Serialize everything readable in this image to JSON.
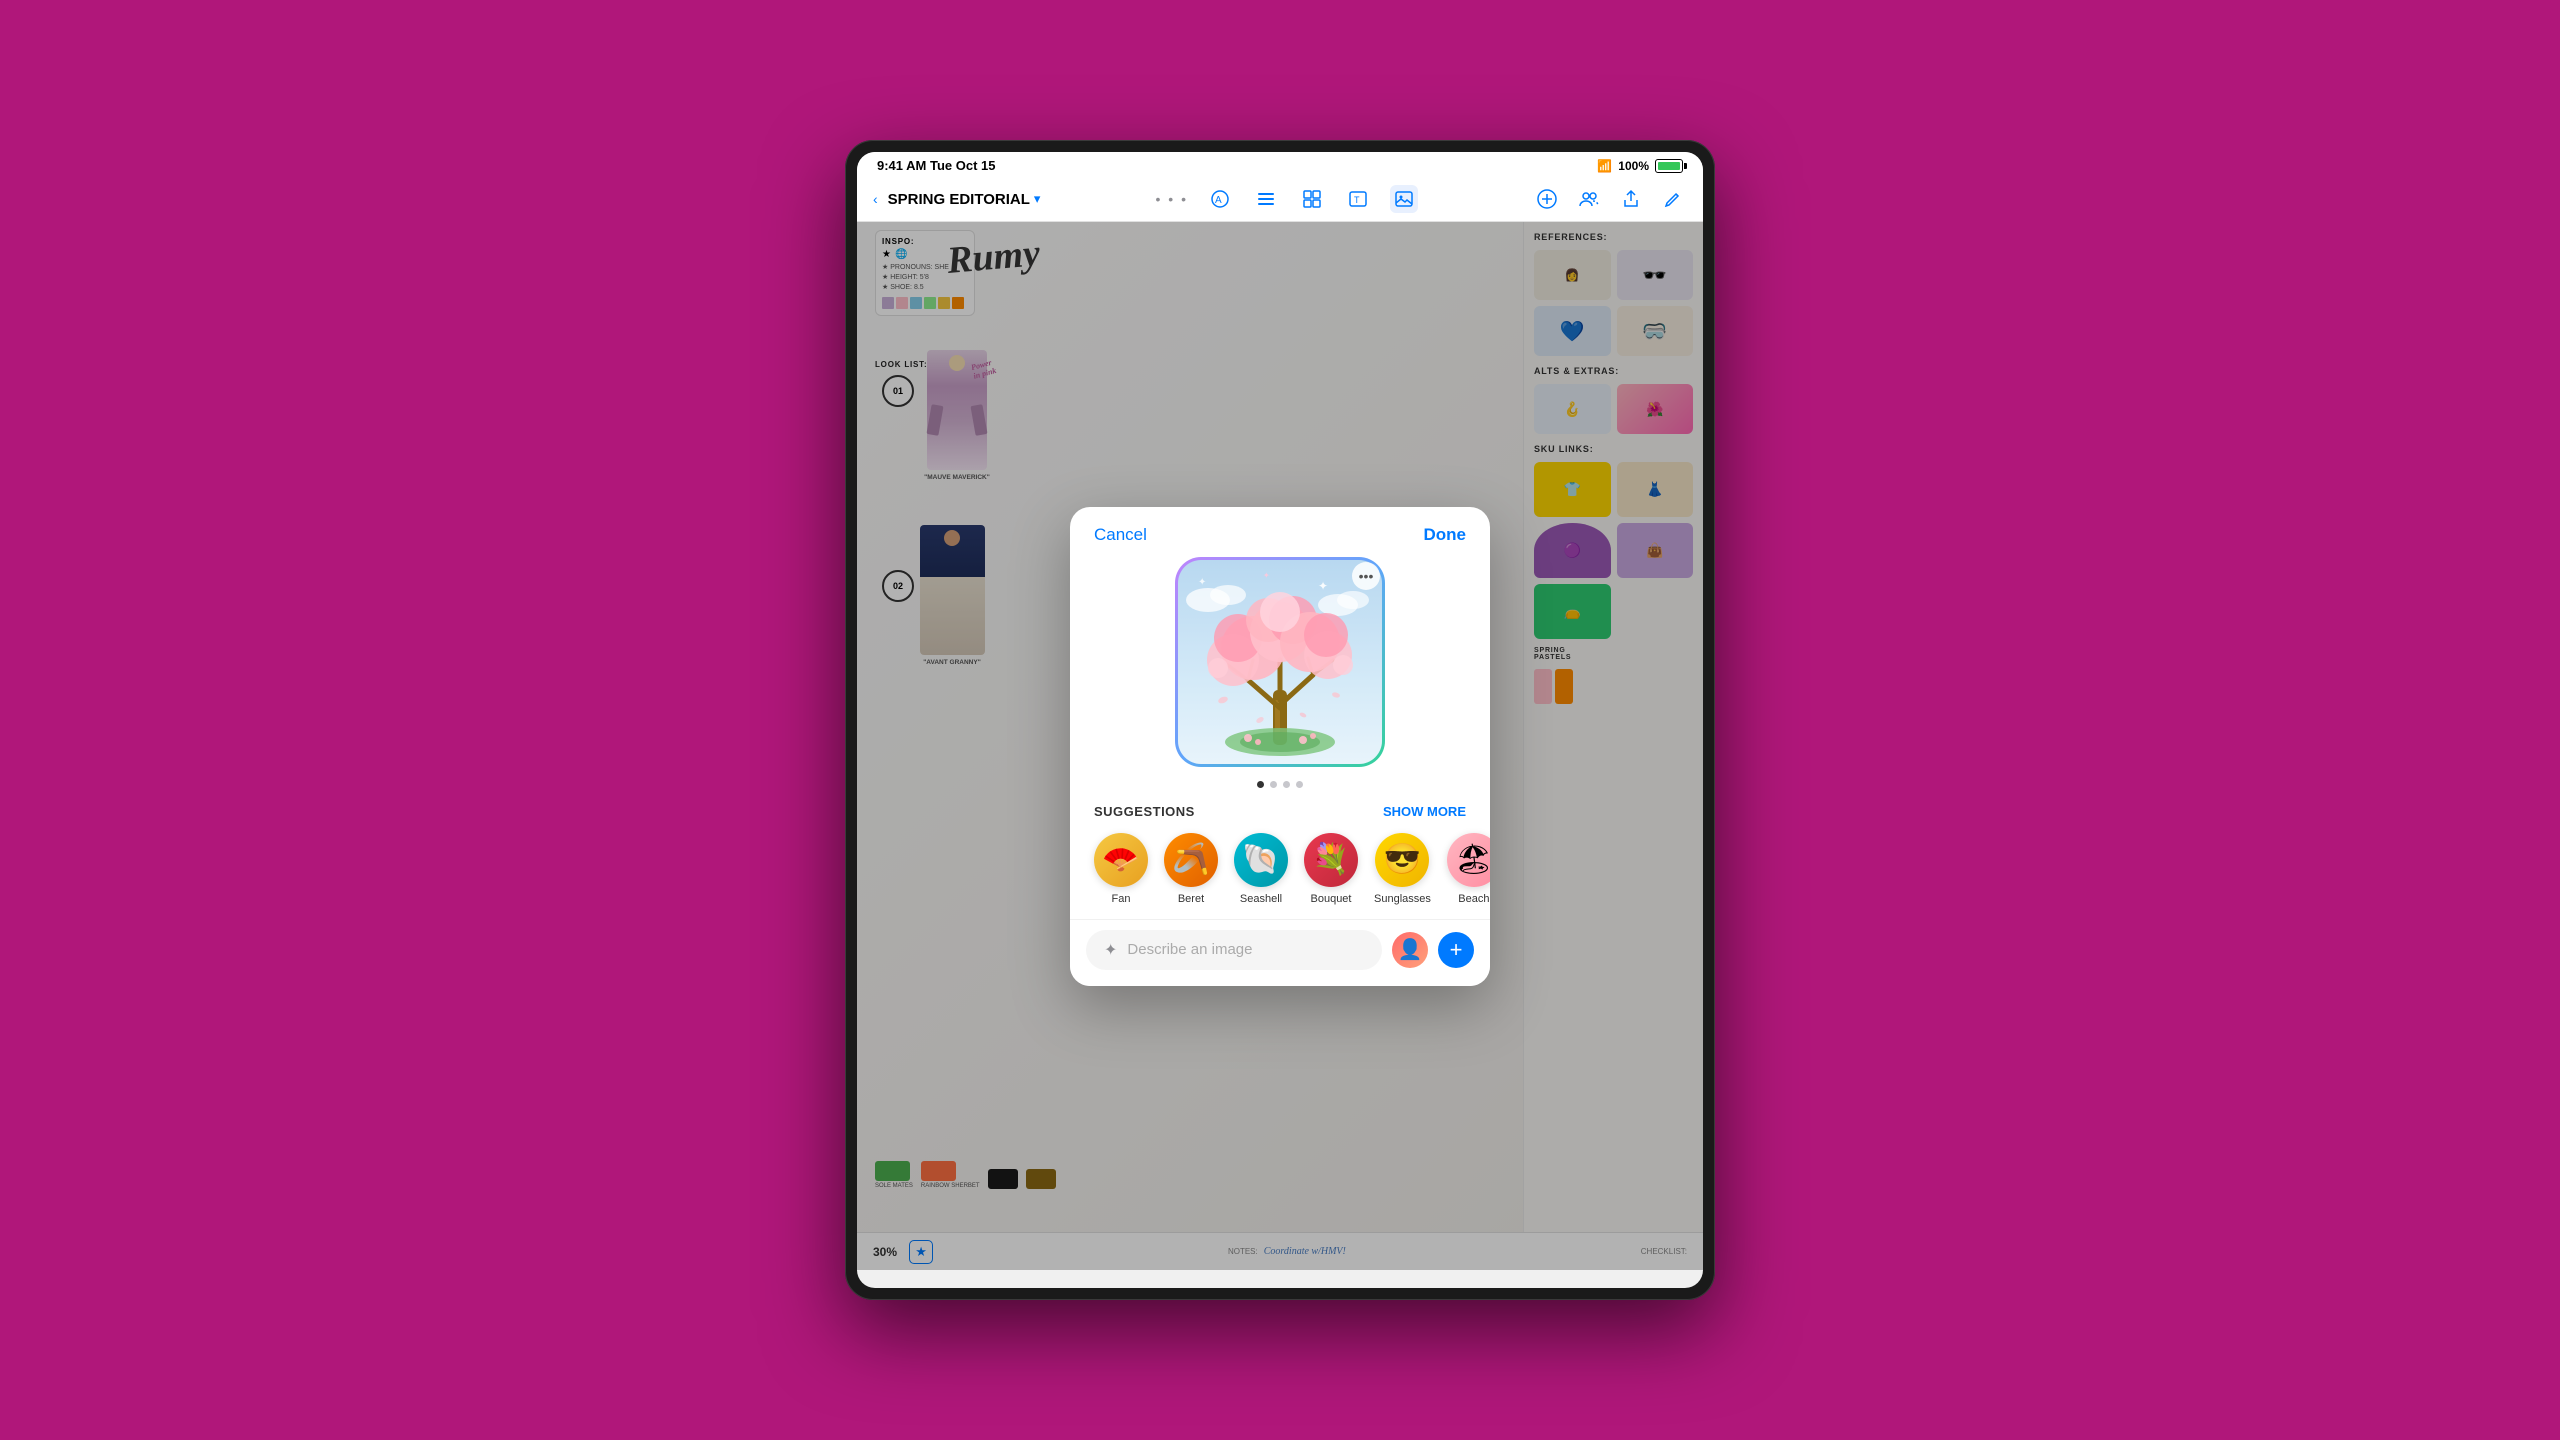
{
  "device": {
    "status_bar": {
      "time": "9:41 AM  Tue Oct 15",
      "wifi": "100%",
      "battery_pct": "100%"
    }
  },
  "toolbar": {
    "back_label": "‹",
    "title": "SPRING EDITORIAL",
    "chevron": "▾",
    "dots": "•••",
    "tool_pen": "✏",
    "tool_text": "A",
    "tool_shapes": "⬡",
    "tool_type": "T",
    "tool_image": "🖼",
    "right_add": "⊕",
    "right_collab": "👥",
    "right_share": "↑",
    "right_edit": "✎"
  },
  "canvas": {
    "sections": {
      "inspo": "INSPO:",
      "look_list": "LOOK LIST:",
      "model1_label": "\"MAUVE MAVERICK\"",
      "model2_label": "\"AVANT GRANNY\"",
      "references": "REFERENCES:",
      "alts_extras": "ALTS & EXTRAS:",
      "sku_links": "SKU LINKS:"
    },
    "cursive_name": "Rumy",
    "notes_label": "NOTES:",
    "checklist_label": "CHECKLIST:"
  },
  "bottom_bar": {
    "zoom": "30%",
    "star": "★"
  },
  "modal": {
    "cancel": "Cancel",
    "done": "Done",
    "carousel_dots": [
      true,
      false,
      false,
      false
    ],
    "suggestions_title": "SUGGESTIONS",
    "show_more": "SHOW MORE",
    "suggestions": [
      {
        "id": "fan",
        "label": "Fan",
        "emoji": "🪭",
        "bg": "#f5c842"
      },
      {
        "id": "beret",
        "label": "Beret",
        "emoji": "🪃",
        "bg": "#ff8c00"
      },
      {
        "id": "seashell",
        "label": "Seashell",
        "emoji": "🐚",
        "bg": "#00bcd4"
      },
      {
        "id": "bouquet",
        "label": "Bouquet",
        "emoji": "💐",
        "bg": "#e8384f"
      },
      {
        "id": "sunglasses",
        "label": "Sunglasses",
        "emoji": "😎",
        "bg": "#ffd700"
      },
      {
        "id": "beach",
        "label": "Beach",
        "emoji": "🏖",
        "bg": "#ffb6c1"
      }
    ],
    "input_placeholder": "Describe an image",
    "ai_icon": "✦"
  },
  "colors": {
    "accent": "#007aff",
    "background": "#b0177a",
    "device_bg": "#1a1a1a",
    "modal_bg": "#ffffff",
    "suggestion_beret_bg": "#ff8c00",
    "suggestion_fan_bg": "#f5c842",
    "suggestion_seashell_bg": "#00bcd4",
    "suggestion_bouquet_bg": "#e8384f",
    "suggestion_sunglasses_bg": "#ffd700",
    "suggestion_beach_bg": "#ffb6c1"
  }
}
